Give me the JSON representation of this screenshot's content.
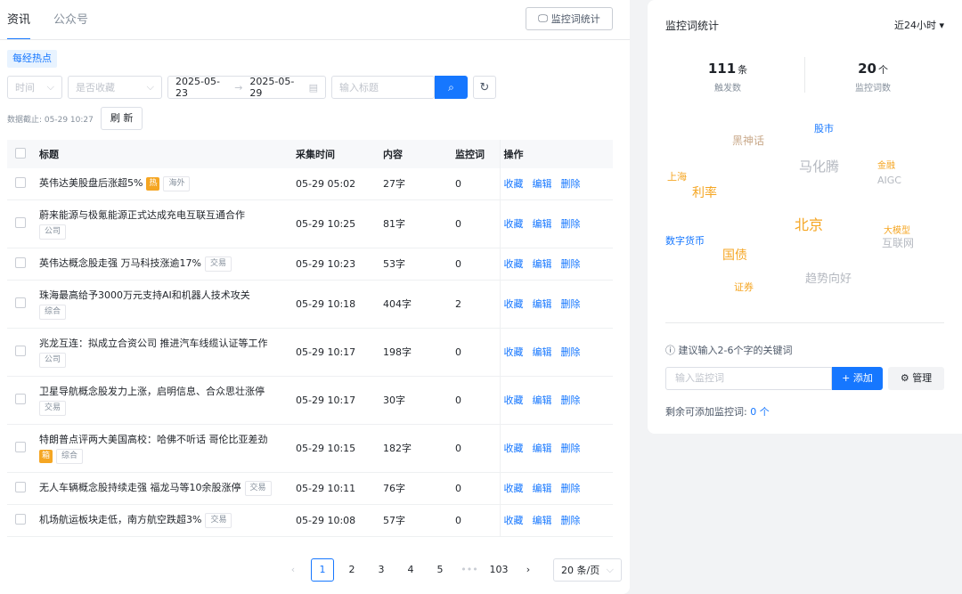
{
  "tabs": [
    "资讯",
    "公众号"
  ],
  "stat_button": "监控词统计",
  "hot_tag": "每经热点",
  "filters": {
    "time": "时间",
    "collected": "是否收藏",
    "date_start": "2025-05-23",
    "date_end": "2025-05-29",
    "title_placeholder": "输入标题"
  },
  "data_cutoff": "数据截止: 05-29 10:27",
  "refresh_label": "刷 新",
  "table": {
    "headers": [
      "标题",
      "采集时间",
      "内容",
      "监控词",
      "操作"
    ],
    "rows": [
      {
        "title": "英伟达美股盘后涨超5%",
        "hot": "热",
        "tags": [
          "海外"
        ],
        "time": "05-29 05:02",
        "content": "27字",
        "count": "0"
      },
      {
        "title": "蔚来能源与极氪能源正式达成充电互联互通合作",
        "hot": "",
        "tags": [
          "公司"
        ],
        "time": "05-29 10:25",
        "content": "81字",
        "count": "0"
      },
      {
        "title": "英伟达概念股走强 万马科技涨逾17%",
        "hot": "",
        "tags": [
          "交易"
        ],
        "time": "05-29 10:23",
        "content": "53字",
        "count": "0"
      },
      {
        "title": "珠海最高给予3000万元支持AI和机器人技术攻关",
        "hot": "",
        "tags": [
          "综合"
        ],
        "time": "05-29 10:18",
        "content": "404字",
        "count": "2"
      },
      {
        "title": "兆龙互连：拟成立合资公司 推进汽车线缆认证等工作",
        "hot": "",
        "tags": [
          "公司"
        ],
        "time": "05-29 10:17",
        "content": "198字",
        "count": "0"
      },
      {
        "title": "卫星导航概念股发力上涨，启明信息、合众思壮涨停",
        "hot": "",
        "tags": [
          "交易"
        ],
        "time": "05-29 10:17",
        "content": "30字",
        "count": "0"
      },
      {
        "title": "特朗普点评两大美国高校：哈佛不听话 哥伦比亚差劲",
        "hot": "箱",
        "tags": [
          "综合"
        ],
        "time": "05-29 10:15",
        "content": "182字",
        "count": "0"
      },
      {
        "title": "无人车辆概念股持续走强 福龙马等10余股涨停",
        "hot": "",
        "tags": [
          "交易"
        ],
        "time": "05-29 10:11",
        "content": "76字",
        "count": "0"
      },
      {
        "title": "机场航运板块走低，南方航空跌超3%",
        "hot": "",
        "tags": [
          "交易"
        ],
        "time": "05-29 10:08",
        "content": "57字",
        "count": "0"
      }
    ],
    "actions": [
      "收藏",
      "编辑",
      "删除"
    ]
  },
  "pager": {
    "pages": [
      "1",
      "2",
      "3",
      "4",
      "5",
      "•••",
      "103"
    ],
    "current": "1",
    "page_size": "20 条/页"
  },
  "right": {
    "title": "监控词统计",
    "range": "近24小时",
    "trigger_count": "111",
    "trigger_unit": "条",
    "trigger_label": "触发数",
    "word_count": "20",
    "word_unit": "个",
    "word_label": "监控词数",
    "cloud": [
      {
        "text": "股市",
        "color": "#1677ff",
        "size": 11
      },
      {
        "text": "黑神话",
        "color": "#c9a98a",
        "size": 12
      },
      {
        "text": "马化腾",
        "color": "#b5b9c0",
        "size": 15
      },
      {
        "text": "金融",
        "color": "#f5a623",
        "size": 10
      },
      {
        "text": "AIGC",
        "color": "#b5b9c0",
        "size": 11
      },
      {
        "text": "上海",
        "color": "#f5a623",
        "size": 11
      },
      {
        "text": "利率",
        "color": "#f5a623",
        "size": 14
      },
      {
        "text": "北京",
        "color": "#f5a623",
        "size": 16
      },
      {
        "text": "大模型",
        "color": "#f5a623",
        "size": 10
      },
      {
        "text": "互联网",
        "color": "#b5b9c0",
        "size": 12
      },
      {
        "text": "数字货币",
        "color": "#1677ff",
        "size": 11
      },
      {
        "text": "国债",
        "color": "#f5a623",
        "size": 14
      },
      {
        "text": "趋势向好",
        "color": "#b5b9c0",
        "size": 13
      },
      {
        "text": "证券",
        "color": "#f5a623",
        "size": 11
      }
    ],
    "tip": "建议输入2-6个字的关键词",
    "kw_placeholder": "输入监控词",
    "add_label": "+ 添加",
    "manage_label": "管理",
    "remain_label": "剩余可添加监控词:",
    "remain_value": "0 个"
  }
}
